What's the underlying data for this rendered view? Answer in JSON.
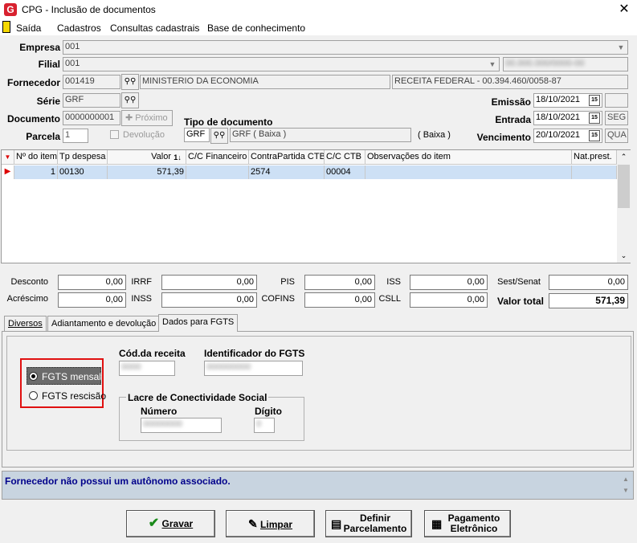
{
  "window": {
    "title": "CPG - Inclusão de documentos",
    "logo": "G",
    "close": "✕"
  },
  "menu": [
    "Saída",
    "Cadastros",
    "Consultas cadastrais",
    "Base de conhecimento"
  ],
  "header": {
    "empresa": {
      "label": "Empresa",
      "value": "001"
    },
    "filial": {
      "label": "Filial",
      "value": "001"
    },
    "fornecedor": {
      "label": "Fornecedor",
      "code": "001419",
      "name": "MINISTERIO DA ECONOMIA",
      "detail": "RECEITA FEDERAL - 00.394.460/0058-87"
    },
    "serie": {
      "label": "Série",
      "value": "GRF"
    },
    "documento": {
      "label": "Documento",
      "value": "0000000001",
      "next_label": "Próximo"
    },
    "parcela": {
      "label": "Parcela",
      "value": "1",
      "devolucao_label": "Devolução"
    },
    "tipo_documento": {
      "label": "Tipo de documento",
      "code": "GRF",
      "desc": "GRF ( Baixa )",
      "type": "( Baixa )"
    },
    "emissao": {
      "label": "Emissão",
      "value": "18/10/2021"
    },
    "entrada": {
      "label": "Entrada",
      "value": "18/10/2021",
      "weekday": "SEG"
    },
    "vencimento": {
      "label": "Vencimento",
      "value": "20/10/2021",
      "weekday": "QUA"
    }
  },
  "grid": {
    "columns": [
      "Nº do item",
      "Tp despesa",
      "Valor",
      "C/C Financeiro",
      "ContraPartida CTB",
      "C/C CTB",
      "Observações do item",
      "Nat.prest."
    ],
    "rows": [
      {
        "item": "1",
        "tp": "00130",
        "valor": "571,39",
        "cc_fin": "",
        "contra": "2574",
        "cc_ctb": "00004",
        "obs": "",
        "nat": ""
      }
    ]
  },
  "totals": {
    "desconto": {
      "label": "Desconto",
      "value": "0,00"
    },
    "acrescimo": {
      "label": "Acréscimo",
      "value": "0,00"
    },
    "irrf": {
      "label": "IRRF",
      "value": "0,00"
    },
    "inss": {
      "label": "INSS",
      "value": "0,00"
    },
    "pis": {
      "label": "PIS",
      "value": "0,00"
    },
    "cofins": {
      "label": "COFINS",
      "value": "0,00"
    },
    "iss": {
      "label": "ISS",
      "value": "0,00"
    },
    "csll": {
      "label": "CSLL",
      "value": "0,00"
    },
    "sest": {
      "label": "Sest/Senat",
      "value": "0,00"
    },
    "total": {
      "label": "Valor total",
      "value": "571,39"
    }
  },
  "tabs": [
    "Diversos",
    "Adiantamento e devolução",
    "Dados para FGTS"
  ],
  "fgts": {
    "options": [
      "FGTS mensal",
      "FGTS rescisão"
    ],
    "cod_receita_label": "Cód.da receita",
    "identificador_label": "Identificador do FGTS",
    "lacre_label": "Lacre de Conectividade Social",
    "numero_label": "Número",
    "digito_label": "Dígito"
  },
  "status": "Fornecedor não possui um autônomo associado.",
  "buttons": {
    "gravar": "Gravar",
    "limpar": "Limpar",
    "definir1": "Definir",
    "definir2": "Parcelamento",
    "pag1": "Pagamento",
    "pag2": "Eletrônico"
  },
  "colors": {
    "accent": "#d8212f",
    "status_text": "#00008b",
    "selection": "#cde0f5"
  }
}
